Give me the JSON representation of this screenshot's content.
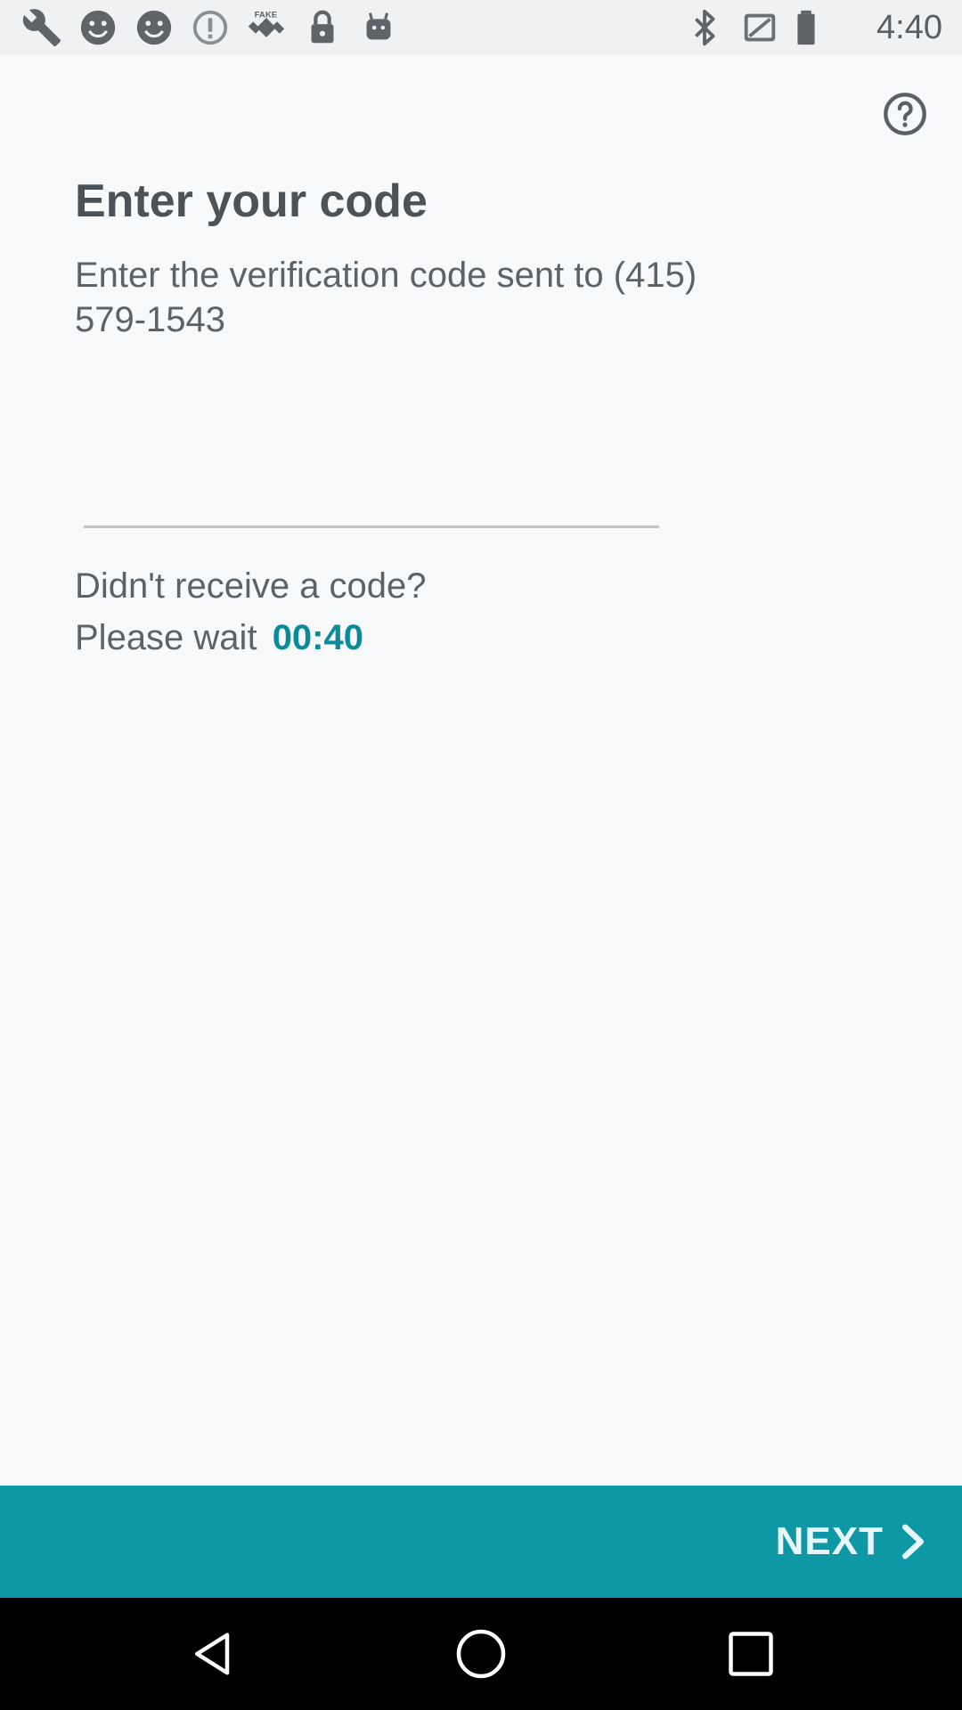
{
  "status_bar": {
    "time": "4:40",
    "left_icons": [
      "wrench-icon",
      "smiley-icon",
      "smiley-icon",
      "info-icon",
      "fake-gps-satellite-icon",
      "lock-icon",
      "android-icon"
    ],
    "right_icons": [
      "bluetooth-icon"
    ]
  },
  "header": {
    "help_icon": "help-circle-icon"
  },
  "main": {
    "title": "Enter your code",
    "subtitle": "Enter the verification code sent to (415) 579-1543",
    "code_input": {
      "value": "",
      "placeholder": ""
    },
    "resend_prompt": "Didn't receive a code?",
    "wait_label": "Please wait",
    "timer": "00:40"
  },
  "footer": {
    "next_label": "NEXT",
    "next_icon": "chevron-right-icon"
  },
  "nav_bar": {
    "icons": [
      "back-icon",
      "home-icon",
      "recents-icon"
    ]
  },
  "colors": {
    "accent": "#0e97a5",
    "timer": "#0b8a99",
    "background": "#f8f9fa",
    "text": "#5c6368",
    "title": "#4b5258"
  }
}
